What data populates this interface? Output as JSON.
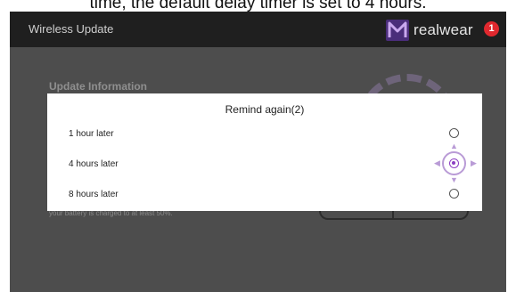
{
  "caption": "time, the default delay timer is set to 4 hours.",
  "titlebar": {
    "app_title": "Wireless Update",
    "brand": "realwear",
    "notification_count": "1"
  },
  "background": {
    "heading": "Update Information",
    "footnote": "your battery is charged to at least 50%."
  },
  "dialog": {
    "title": "Remind again(2)",
    "options": [
      {
        "label": "1 hour later",
        "selected": false
      },
      {
        "label": "4 hours later",
        "selected": true
      },
      {
        "label": "8 hours later",
        "selected": false
      }
    ]
  },
  "colors": {
    "accent": "#8c3fc2",
    "titlebar": "#1f1f1f",
    "screen_dim": "#4d4d4d",
    "badge": "#e0282e"
  },
  "icons": {
    "brand_logo": "realwear-logo-icon",
    "dpad": [
      "dpad-up-icon",
      "dpad-down-icon",
      "dpad-left-icon",
      "dpad-right-icon"
    ]
  }
}
